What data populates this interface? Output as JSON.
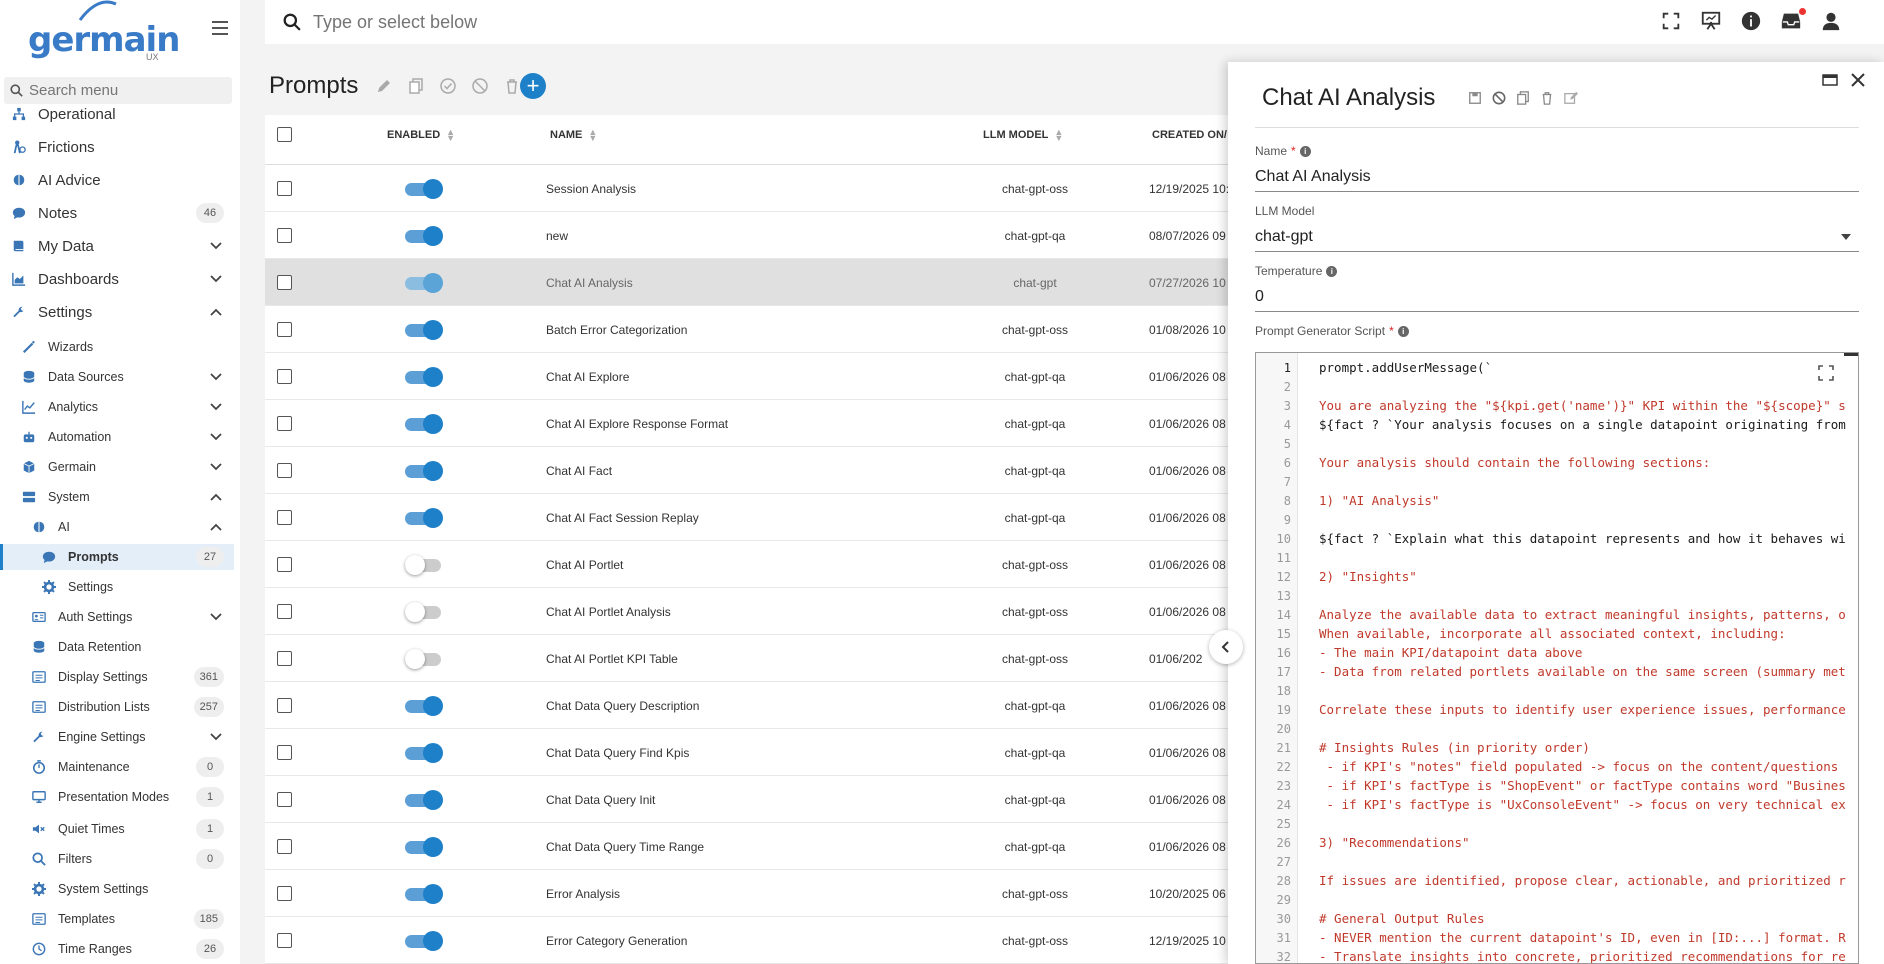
{
  "app": {
    "brand": "germain",
    "brand_sub": "UX"
  },
  "sidebar": {
    "search_placeholder": "Search menu",
    "items": [
      {
        "label": "Operational",
        "icon": "sitemap-icon",
        "level": 1
      },
      {
        "label": "Frictions",
        "icon": "person-friction-icon",
        "level": 1
      },
      {
        "label": "AI Advice",
        "icon": "brain-icon",
        "level": 1
      },
      {
        "label": "Notes",
        "icon": "comment-icon",
        "level": 1,
        "count": "46"
      },
      {
        "label": "My Data",
        "icon": "book-icon",
        "level": 1,
        "chevron": "down"
      },
      {
        "label": "Dashboards",
        "icon": "chart-area-icon",
        "level": 1,
        "chevron": "down"
      },
      {
        "label": "Settings",
        "icon": "wrench-icon",
        "level": 1,
        "chevron": "up"
      },
      {
        "label": "Wizards",
        "icon": "magic-wand-icon",
        "level": 2
      },
      {
        "label": "Data Sources",
        "icon": "database-icon",
        "level": 2,
        "chevron": "down"
      },
      {
        "label": "Analytics",
        "icon": "line-chart-icon",
        "level": 2,
        "chevron": "down"
      },
      {
        "label": "Automation",
        "icon": "robot-icon",
        "level": 2,
        "chevron": "down"
      },
      {
        "label": "Germain",
        "icon": "cube-icon",
        "level": 2,
        "chevron": "down"
      },
      {
        "label": "System",
        "icon": "server-icon",
        "level": 2,
        "chevron": "up"
      },
      {
        "label": "AI",
        "icon": "brain-icon",
        "level": 3,
        "chevron": "up"
      },
      {
        "label": "Prompts",
        "icon": "comment-icon",
        "level": 4,
        "count": "27",
        "active": true
      },
      {
        "label": "Settings",
        "icon": "gear-icon",
        "level": 4
      },
      {
        "label": "Auth Settings",
        "icon": "id-card-icon",
        "level": 3,
        "chevron": "down"
      },
      {
        "label": "Data Retention",
        "icon": "database-icon",
        "level": 3
      },
      {
        "label": "Display Settings",
        "icon": "list-icon",
        "level": 3,
        "count": "361"
      },
      {
        "label": "Distribution Lists",
        "icon": "list-icon",
        "level": 3,
        "count": "257"
      },
      {
        "label": "Engine Settings",
        "icon": "wrench-icon",
        "level": 3,
        "chevron": "down"
      },
      {
        "label": "Maintenance",
        "icon": "stopwatch-icon",
        "level": 3,
        "count": "0"
      },
      {
        "label": "Presentation Modes",
        "icon": "desktop-icon",
        "level": 3,
        "count": "1"
      },
      {
        "label": "Quiet Times",
        "icon": "volume-mute-icon",
        "level": 3,
        "count": "1"
      },
      {
        "label": "Filters",
        "icon": "search-icon",
        "level": 3,
        "count": "0"
      },
      {
        "label": "System Settings",
        "icon": "gear-icon",
        "level": 3
      },
      {
        "label": "Templates",
        "icon": "list-icon",
        "level": 3,
        "count": "185"
      },
      {
        "label": "Time Ranges",
        "icon": "clock-icon",
        "level": 3,
        "count": "26"
      }
    ]
  },
  "topbar": {
    "search_placeholder": "Type or select below"
  },
  "page": {
    "title": "Prompts"
  },
  "table": {
    "columns": {
      "enabled": "ENABLED",
      "name": "NAME",
      "llm": "LLM MODEL",
      "created": "CREATED ON/"
    },
    "rows": [
      {
        "enabled": true,
        "name": "Session Analysis",
        "llm": "chat-gpt-oss",
        "created": "12/19/2025 10:"
      },
      {
        "enabled": true,
        "name": "new",
        "llm": "chat-gpt-qa",
        "created": "08/07/2026 09"
      },
      {
        "enabled": true,
        "name": "Chat AI Analysis",
        "llm": "chat-gpt",
        "created": "07/27/2026 10",
        "selected": true
      },
      {
        "enabled": true,
        "name": "Batch Error Categorization",
        "llm": "chat-gpt-oss",
        "created": "01/08/2026 10"
      },
      {
        "enabled": true,
        "name": "Chat AI Explore",
        "llm": "chat-gpt-qa",
        "created": "01/06/2026 08"
      },
      {
        "enabled": true,
        "name": "Chat AI Explore Response Format",
        "llm": "chat-gpt-qa",
        "created": "01/06/2026 08"
      },
      {
        "enabled": true,
        "name": "Chat AI Fact",
        "llm": "chat-gpt-qa",
        "created": "01/06/2026 08"
      },
      {
        "enabled": true,
        "name": "Chat AI Fact Session Replay",
        "llm": "chat-gpt-qa",
        "created": "01/06/2026 08"
      },
      {
        "enabled": false,
        "name": "Chat AI Portlet",
        "llm": "chat-gpt-oss",
        "created": "01/06/2026 08"
      },
      {
        "enabled": false,
        "name": "Chat AI Portlet Analysis",
        "llm": "chat-gpt-oss",
        "created": "01/06/2026 08"
      },
      {
        "enabled": false,
        "name": "Chat AI Portlet KPI Table",
        "llm": "chat-gpt-oss",
        "created": "01/06/202"
      },
      {
        "enabled": true,
        "name": "Chat Data Query Description",
        "llm": "chat-gpt-qa",
        "created": "01/06/2026 08"
      },
      {
        "enabled": true,
        "name": "Chat Data Query Find Kpis",
        "llm": "chat-gpt-qa",
        "created": "01/06/2026 08"
      },
      {
        "enabled": true,
        "name": "Chat Data Query Init",
        "llm": "chat-gpt-qa",
        "created": "01/06/2026 08"
      },
      {
        "enabled": true,
        "name": "Chat Data Query Time Range",
        "llm": "chat-gpt-qa",
        "created": "01/06/2026 08"
      },
      {
        "enabled": true,
        "name": "Error Analysis",
        "llm": "chat-gpt-oss",
        "created": "10/20/2025 06"
      },
      {
        "enabled": true,
        "name": "Error Category Generation",
        "llm": "chat-gpt-oss",
        "created": "12/19/2025 10"
      }
    ]
  },
  "panel": {
    "title": "Chat AI Analysis",
    "name_label": "Name",
    "name_value": "Chat AI Analysis",
    "llm_label": "LLM Model",
    "llm_value": "chat-gpt",
    "temp_label": "Temperature",
    "temp_value": "0",
    "script_label": "Prompt Generator Script",
    "code_lines": [
      "prompt.addUserMessage(`",
      "",
      "You are analyzing the \"${kpi.get('name')}\" KPI within the \"${scope}\" s",
      "${fact ? `Your analysis focuses on a single datapoint originating from",
      "",
      "Your analysis should contain the following sections:",
      "",
      "1) \"AI Analysis\"",
      "",
      "${fact ? `Explain what this datapoint represents and how it behaves wi",
      "",
      "2) \"Insights\"",
      "",
      "Analyze the available data to extract meaningful insights, patterns, o",
      "When available, incorporate all associated context, including:",
      "- The main KPI/datapoint data above",
      "- Data from related portlets available on the same screen (summary met",
      "",
      "Correlate these inputs to identify user experience issues, performance",
      "",
      "# Insights Rules (in priority order)",
      " - if KPI's \"notes\" field populated -> focus on the content/questions",
      " - if KPI's factType is \"ShopEvent\" or factType contains word \"Busines",
      " - if KPI's factType is \"UxConsoleEvent\" -> focus on very technical ex",
      "",
      "3) \"Recommendations\"",
      "",
      "If issues are identified, propose clear, actionable, and prioritized r",
      "",
      "# General Output Rules",
      "- NEVER mention the current datapoint's ID, even in [ID:...] format. R",
      "- Translate insights into concrete, prioritized recommendations for re"
    ]
  }
}
